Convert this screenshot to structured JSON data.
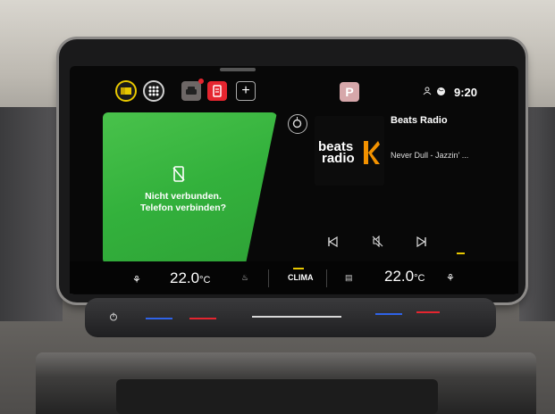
{
  "status_bar": {
    "time": "9:20",
    "profile_letter": "P",
    "plus_label": "+"
  },
  "phone": {
    "message_line1": "Nicht verbunden.",
    "message_line2": "Telefon verbinden?"
  },
  "media": {
    "station": "Beats Radio",
    "track": "Never Dull - Jazzin' ...",
    "logo_line1": "beats",
    "logo_line2": "radio"
  },
  "climate": {
    "left_temp": "22.0",
    "right_temp": "22.0",
    "unit": "°C",
    "center_label": "CLIMA"
  },
  "colors": {
    "phone_green": "#3bb843",
    "accent_yellow": "#e8c800",
    "app_red": "#e5252f",
    "profile_pink": "#d6a7aa",
    "beats_orange": "#f39200"
  }
}
